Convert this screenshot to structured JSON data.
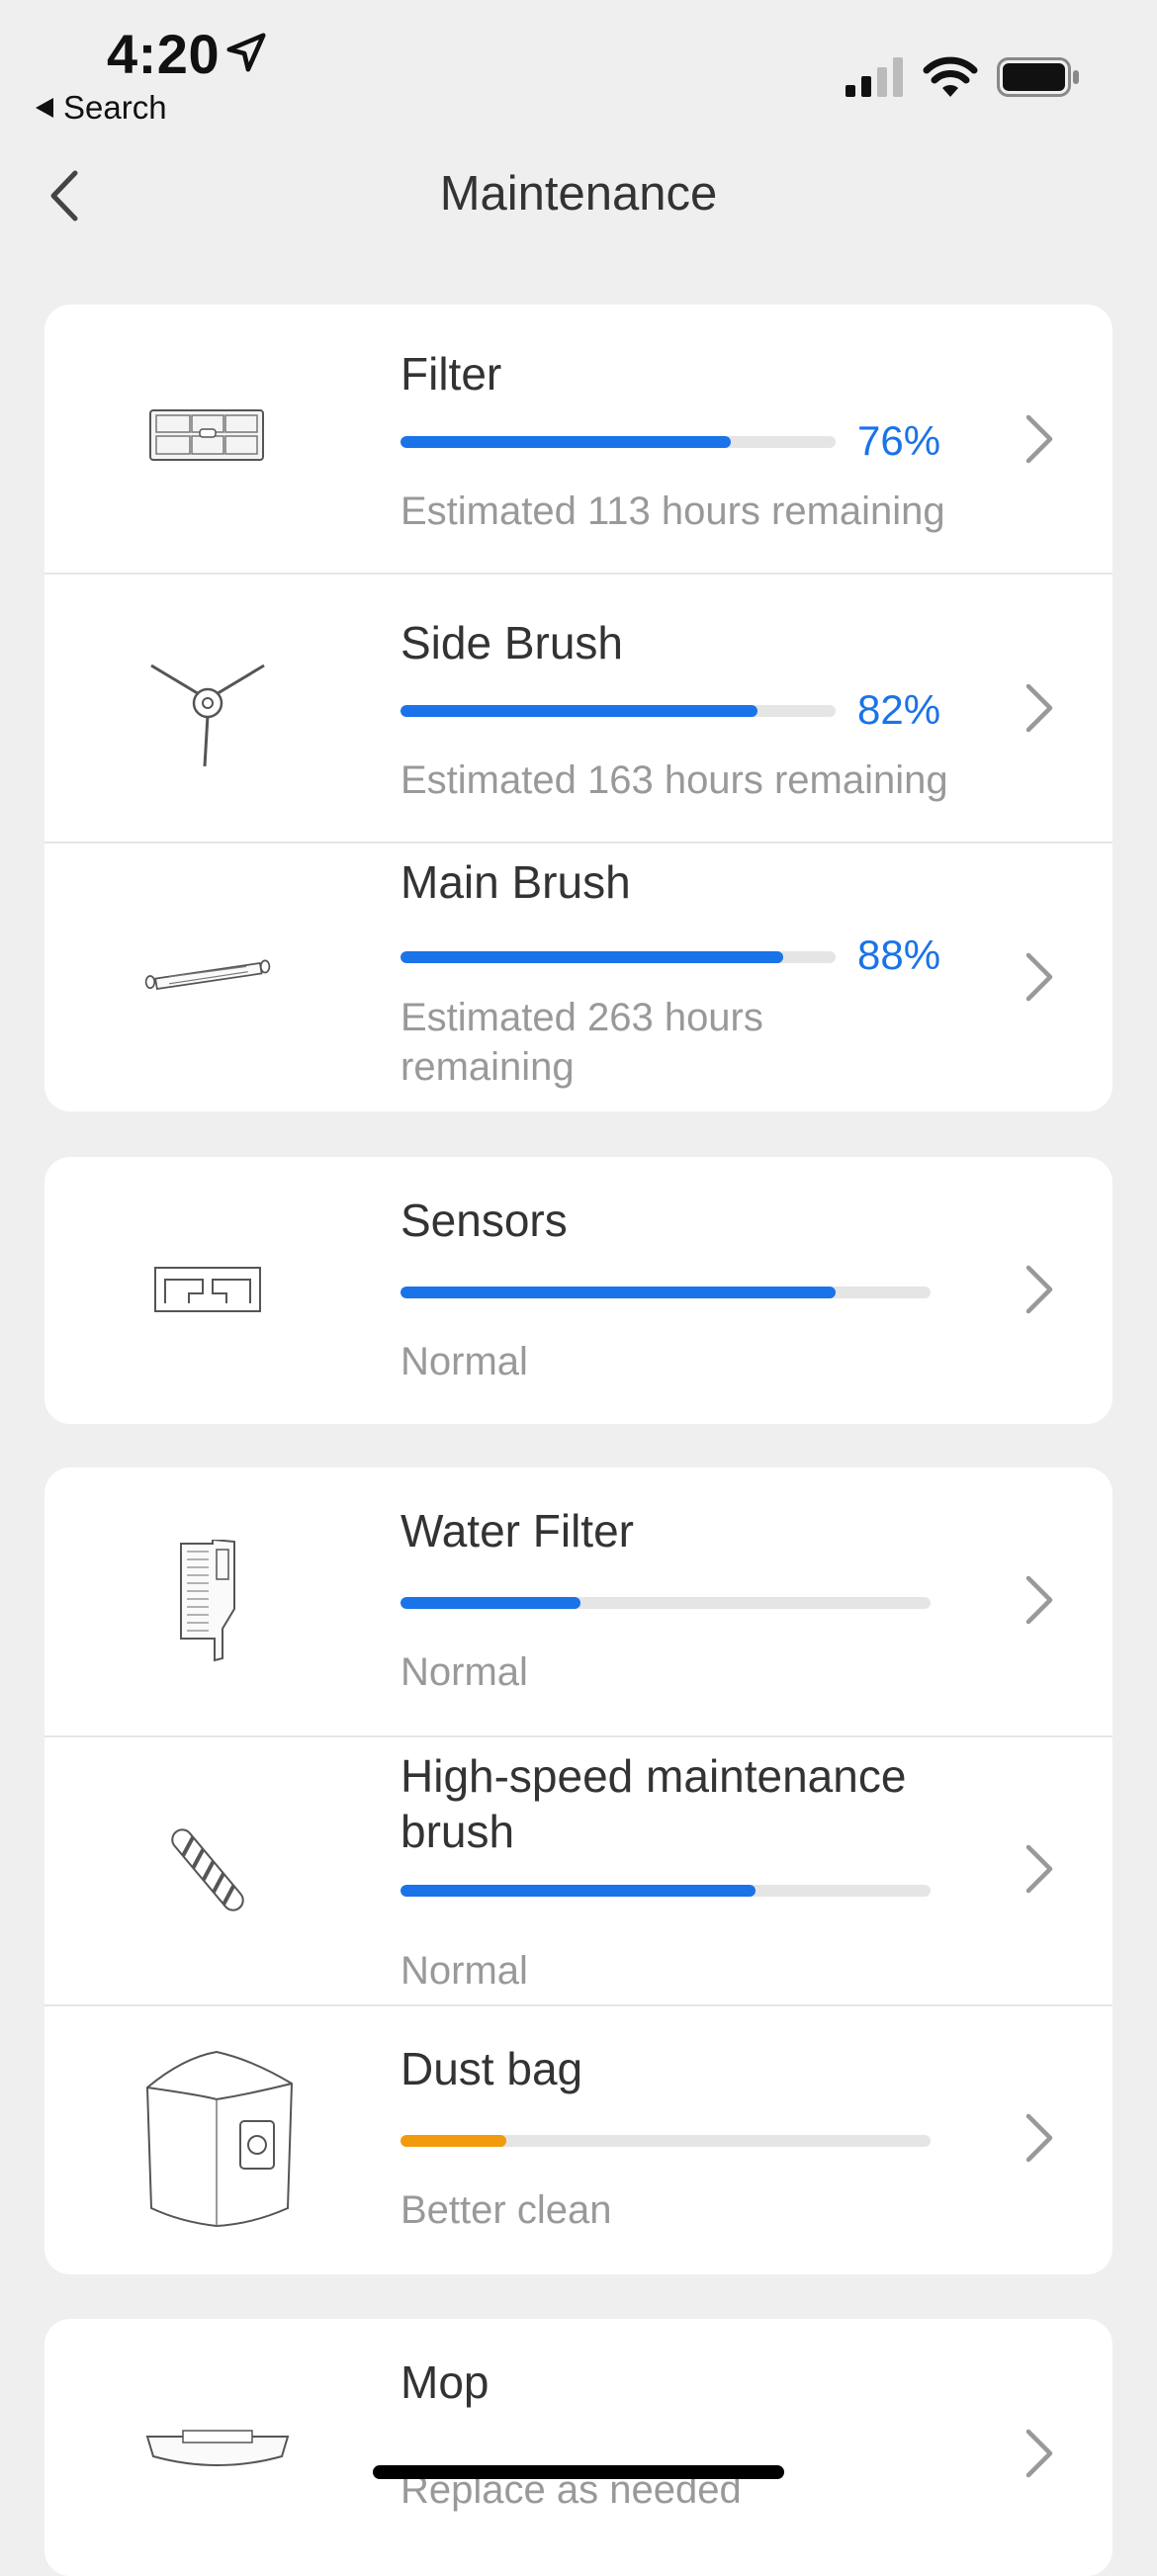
{
  "status": {
    "time": "4:20",
    "back_label": "Search"
  },
  "nav": {
    "title": "Maintenance"
  },
  "groups": [
    {
      "items": [
        {
          "name": "Filter",
          "progress": 0.76,
          "percent": "76%",
          "status": "Estimated 113 hours remaining",
          "icon": "filter-icon"
        },
        {
          "name": "Side Brush",
          "progress": 0.82,
          "percent": "82%",
          "status": "Estimated 163 hours remaining",
          "icon": "side-brush-icon"
        },
        {
          "name": "Main Brush",
          "progress": 0.88,
          "percent": "88%",
          "status": "Estimated 263 hours remaining",
          "icon": "main-brush-icon"
        }
      ]
    },
    {
      "items": [
        {
          "name": "Sensors",
          "progress": 0.82,
          "status": "Normal",
          "icon": "sensors-icon"
        }
      ]
    },
    {
      "items": [
        {
          "name": "Water Filter",
          "progress": 0.34,
          "status": "Normal",
          "icon": "water-filter-icon"
        },
        {
          "name": "High-speed maintenance brush",
          "progress": 0.67,
          "status": "Normal",
          "icon": "maintenance-brush-icon"
        },
        {
          "name": "Dust bag",
          "progress": 0.2,
          "status": "Better clean",
          "icon": "dust-bag-icon",
          "color": "#f29a0e"
        }
      ]
    },
    {
      "items": [
        {
          "name": "Mop",
          "status": "Replace as needed",
          "icon": "mop-icon"
        }
      ]
    }
  ],
  "colors": {
    "accent": "#1a73e8",
    "warning": "#f29a0e",
    "background": "#efeff0"
  }
}
